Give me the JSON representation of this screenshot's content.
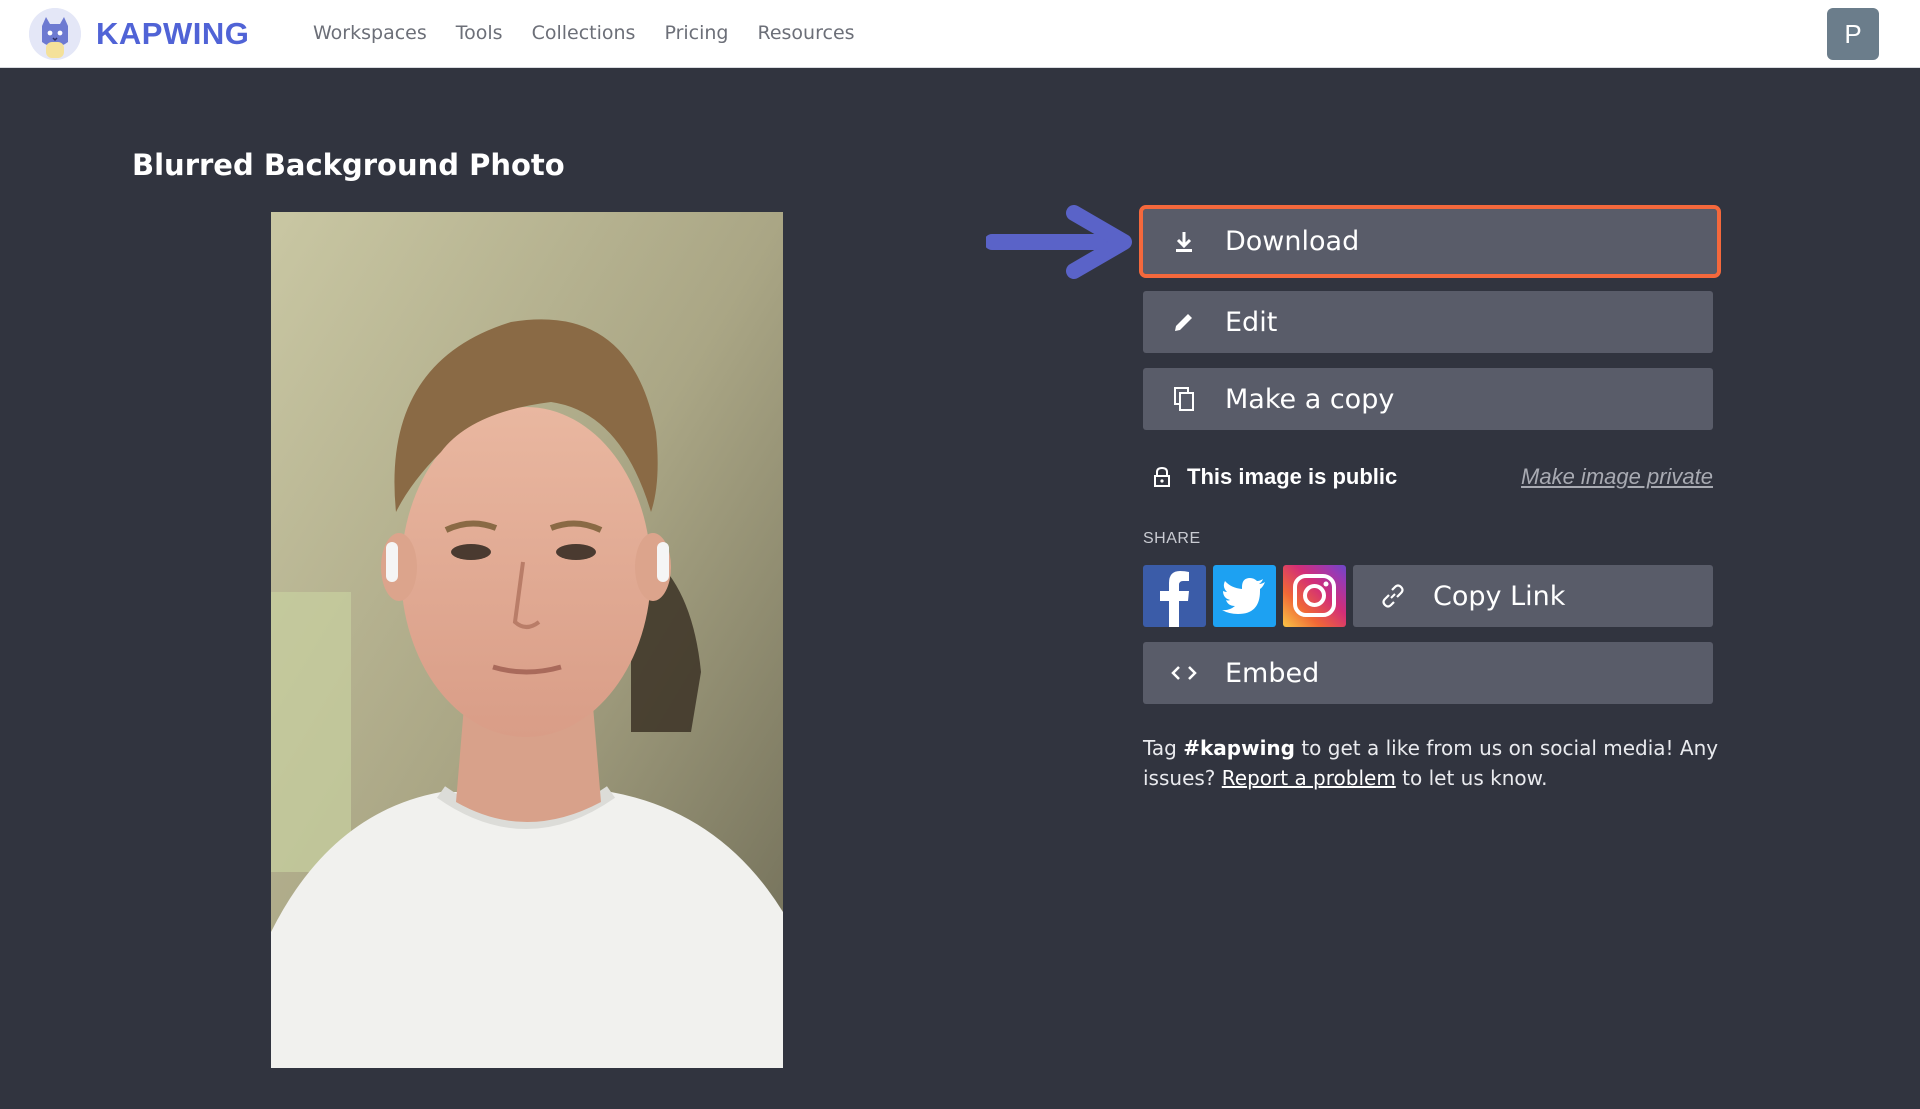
{
  "brand": {
    "name": "KAPWING",
    "color": "#5063d6"
  },
  "nav": {
    "items": [
      "Workspaces",
      "Tools",
      "Collections",
      "Pricing",
      "Resources"
    ]
  },
  "user": {
    "avatar_letter": "P"
  },
  "page": {
    "title": "Blurred Background Photo"
  },
  "actions": {
    "download": "Download",
    "edit": "Edit",
    "copy": "Make a copy",
    "copy_link": "Copy Link",
    "embed": "Embed"
  },
  "privacy": {
    "status": "This image is public",
    "toggle_link": "Make image private"
  },
  "share": {
    "label": "SHARE"
  },
  "note": {
    "tag_prefix": "Tag ",
    "hashtag": "#kapwing",
    "tag_suffix": " to get a like from us on social media! Any issues? ",
    "report_link": "Report a problem",
    "end": " to let us know."
  },
  "colors": {
    "highlight": "#f4683c",
    "arrow": "#5a63c8",
    "button_bg": "#595c69",
    "page_bg": "#31343f"
  },
  "icons": [
    "download-icon",
    "pencil-icon",
    "copy-icon",
    "lock-icon",
    "facebook-icon",
    "twitter-icon",
    "instagram-icon",
    "link-icon",
    "code-icon"
  ]
}
